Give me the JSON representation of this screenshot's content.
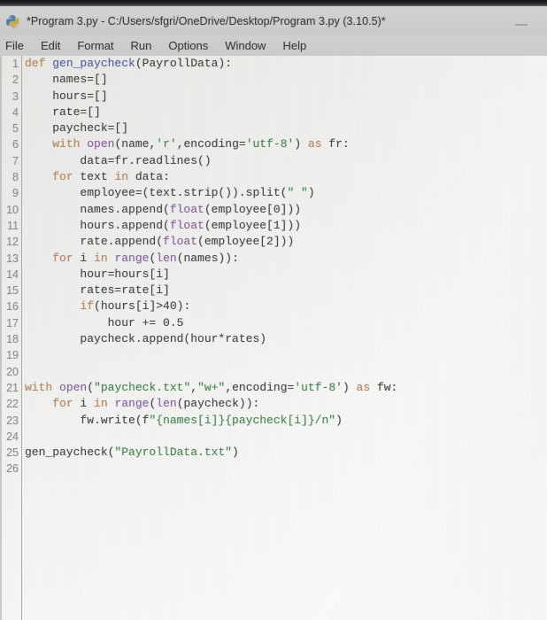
{
  "window": {
    "title": "*Program 3.py - C:/Users/sfgri/OneDrive/Desktop/Program 3.py (3.10.5)*",
    "app_icon": "python-icon",
    "minimize_label": "—"
  },
  "menubar": {
    "items": [
      {
        "label": "File"
      },
      {
        "label": "Edit"
      },
      {
        "label": "Format"
      },
      {
        "label": "Run"
      },
      {
        "label": "Options"
      },
      {
        "label": "Window"
      },
      {
        "label": "Help"
      }
    ]
  },
  "editor": {
    "colors": {
      "keyword": "#c08552",
      "definition": "#4f5fa8",
      "builtin": "#8a5fa8",
      "string": "#3f8a4e",
      "text": "#43433f",
      "background": "#eaeae8",
      "line_number": "#8e8e8c"
    },
    "lines": [
      {
        "n": "1",
        "tokens": [
          {
            "t": "def",
            "c": "kw"
          },
          {
            "t": " ",
            "c": ""
          },
          {
            "t": "gen_paycheck",
            "c": "fn"
          },
          {
            "t": "(PayrollData):",
            "c": ""
          }
        ]
      },
      {
        "n": "2",
        "tokens": [
          {
            "t": "    names=[]",
            "c": ""
          }
        ]
      },
      {
        "n": "3",
        "tokens": [
          {
            "t": "    hours=[]",
            "c": ""
          }
        ]
      },
      {
        "n": "4",
        "tokens": [
          {
            "t": "    rate=[]",
            "c": ""
          }
        ]
      },
      {
        "n": "5",
        "tokens": [
          {
            "t": "    paycheck=[]",
            "c": ""
          }
        ]
      },
      {
        "n": "6",
        "tokens": [
          {
            "t": "    ",
            "c": ""
          },
          {
            "t": "with",
            "c": "kw"
          },
          {
            "t": " ",
            "c": ""
          },
          {
            "t": "open",
            "c": "bi"
          },
          {
            "t": "(name,",
            "c": ""
          },
          {
            "t": "'r'",
            "c": "str"
          },
          {
            "t": ",encoding=",
            "c": ""
          },
          {
            "t": "'utf-8'",
            "c": "str"
          },
          {
            "t": ") ",
            "c": ""
          },
          {
            "t": "as",
            "c": "kw"
          },
          {
            "t": " fr:",
            "c": ""
          }
        ]
      },
      {
        "n": "7",
        "tokens": [
          {
            "t": "        data=fr.readlines()",
            "c": ""
          }
        ]
      },
      {
        "n": "8",
        "tokens": [
          {
            "t": "    ",
            "c": ""
          },
          {
            "t": "for",
            "c": "kw"
          },
          {
            "t": " text ",
            "c": ""
          },
          {
            "t": "in",
            "c": "kw"
          },
          {
            "t": " data:",
            "c": ""
          }
        ]
      },
      {
        "n": "9",
        "tokens": [
          {
            "t": "        employee=(text.strip()).split(",
            "c": ""
          },
          {
            "t": "\" \"",
            "c": "str"
          },
          {
            "t": ")",
            "c": ""
          }
        ]
      },
      {
        "n": "10",
        "tokens": [
          {
            "t": "        names.append(",
            "c": ""
          },
          {
            "t": "float",
            "c": "bi"
          },
          {
            "t": "(employee[0]))",
            "c": ""
          }
        ]
      },
      {
        "n": "11",
        "tokens": [
          {
            "t": "        hours.append(",
            "c": ""
          },
          {
            "t": "float",
            "c": "bi"
          },
          {
            "t": "(employee[1]))",
            "c": ""
          }
        ]
      },
      {
        "n": "12",
        "tokens": [
          {
            "t": "        rate.append(",
            "c": ""
          },
          {
            "t": "float",
            "c": "bi"
          },
          {
            "t": "(employee[2]))",
            "c": ""
          }
        ]
      },
      {
        "n": "13",
        "tokens": [
          {
            "t": "    ",
            "c": ""
          },
          {
            "t": "for",
            "c": "kw"
          },
          {
            "t": " i ",
            "c": ""
          },
          {
            "t": "in",
            "c": "kw"
          },
          {
            "t": " ",
            "c": ""
          },
          {
            "t": "range",
            "c": "bi"
          },
          {
            "t": "(",
            "c": ""
          },
          {
            "t": "len",
            "c": "bi"
          },
          {
            "t": "(names)):",
            "c": ""
          }
        ]
      },
      {
        "n": "14",
        "tokens": [
          {
            "t": "        hour=hours[i]",
            "c": ""
          }
        ]
      },
      {
        "n": "15",
        "tokens": [
          {
            "t": "        rates=rate[i]",
            "c": ""
          }
        ]
      },
      {
        "n": "16",
        "tokens": [
          {
            "t": "        ",
            "c": ""
          },
          {
            "t": "if",
            "c": "kw"
          },
          {
            "t": "(hours[i]>40):",
            "c": ""
          }
        ]
      },
      {
        "n": "17",
        "tokens": [
          {
            "t": "            hour += 0.5",
            "c": ""
          }
        ]
      },
      {
        "n": "18",
        "tokens": [
          {
            "t": "        paycheck.append(hour*rates)",
            "c": ""
          }
        ]
      },
      {
        "n": "19",
        "tokens": [
          {
            "t": "",
            "c": ""
          }
        ]
      },
      {
        "n": "20",
        "tokens": [
          {
            "t": "",
            "c": ""
          }
        ]
      },
      {
        "n": "21",
        "tokens": [
          {
            "t": "with",
            "c": "kw"
          },
          {
            "t": " ",
            "c": ""
          },
          {
            "t": "open",
            "c": "bi"
          },
          {
            "t": "(",
            "c": ""
          },
          {
            "t": "\"paycheck.txt\"",
            "c": "str"
          },
          {
            "t": ",",
            "c": ""
          },
          {
            "t": "\"w+\"",
            "c": "str"
          },
          {
            "t": ",encoding=",
            "c": ""
          },
          {
            "t": "'utf-8'",
            "c": "str"
          },
          {
            "t": ") ",
            "c": ""
          },
          {
            "t": "as",
            "c": "kw"
          },
          {
            "t": " fw:",
            "c": ""
          }
        ]
      },
      {
        "n": "22",
        "tokens": [
          {
            "t": "    ",
            "c": ""
          },
          {
            "t": "for",
            "c": "kw"
          },
          {
            "t": " i ",
            "c": ""
          },
          {
            "t": "in",
            "c": "kw"
          },
          {
            "t": " ",
            "c": ""
          },
          {
            "t": "range",
            "c": "bi"
          },
          {
            "t": "(",
            "c": ""
          },
          {
            "t": "len",
            "c": "bi"
          },
          {
            "t": "(paycheck)):",
            "c": ""
          }
        ]
      },
      {
        "n": "23",
        "tokens": [
          {
            "t": "        fw.write(f",
            "c": ""
          },
          {
            "t": "\"{names[i]}{paycheck[i]}/n\"",
            "c": "str"
          },
          {
            "t": ")",
            "c": ""
          }
        ]
      },
      {
        "n": "24",
        "tokens": [
          {
            "t": "",
            "c": ""
          }
        ]
      },
      {
        "n": "25",
        "tokens": [
          {
            "t": "gen_paycheck(",
            "c": ""
          },
          {
            "t": "\"PayrollData.txt\"",
            "c": "str"
          },
          {
            "t": ")",
            "c": ""
          }
        ]
      },
      {
        "n": "26",
        "tokens": [
          {
            "t": "",
            "c": ""
          }
        ]
      }
    ]
  }
}
